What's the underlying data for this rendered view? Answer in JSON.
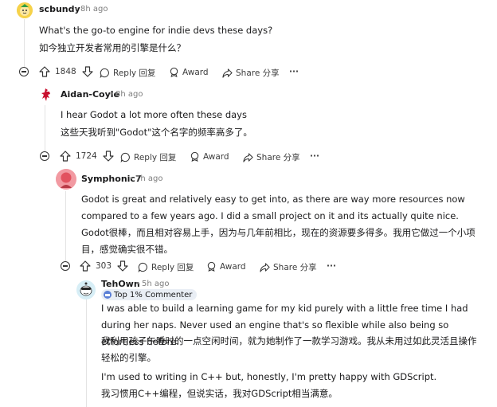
{
  "comments": [
    {
      "user": "scbundy",
      "time": "8h ago",
      "text_en": "What's the go-to engine for indie devs these days?",
      "text_zh": "如今独立开发者常用的引擎是什么？",
      "votes": "1848",
      "reply_label": "Reply 回复",
      "award_label": "Award",
      "share_label": "Share 分享",
      "more_label": "···"
    },
    {
      "user": "Aidan-Coyle",
      "time": "8h ago",
      "text_en": "I hear Godot a lot more often these days",
      "text_zh": "这些天我听到\"Godot\"这个名字的频率高多了。",
      "votes": "1724",
      "reply_label": "Reply 回复",
      "award_label": "Award",
      "share_label": "Share 分享",
      "more_label": "···"
    },
    {
      "user": "Symphonic7",
      "time": "7h ago",
      "text_en": "Godot is great and relatively easy to get into, as there are way more resources now compared to a few years ago. I did a small project on it and its actually quite nice.",
      "text_zh": "Godot很棒，而且相对容易上手，因为与几年前相比，现在的资源要多得多。我用它做过一个小项目，感觉确实很不错。",
      "votes": "303",
      "reply_label": "Reply 回复",
      "award_label": "Award",
      "share_label": "Share 分享",
      "more_label": "···"
    },
    {
      "user": "TehOwn",
      "time": "5h ago",
      "flair": "Top 1% Commenter",
      "text_en": "I was able to build a learning game for my kid purely with a little free time I had during her naps. Never used an engine that's so flexible while also being so effortless before.",
      "text_zh": "我利用孩子午睡时的一点空闲时间，就为她制作了一款学习游戏。我从未用过如此灵活且操作轻松的引擎。",
      "text_en_2": "I'm used to writing in C++ but, honestly, I'm pretty happy with GDScript.",
      "text_zh_2": "我习惯用C++编程，但说实话，我对GDScript相当满意。"
    }
  ],
  "separator": "•",
  "colors": {
    "text": "#1a1a1b",
    "meta": "#7c7c7c",
    "thread_line": "#e3e3e3",
    "flair_bg": "#e9eef5"
  }
}
